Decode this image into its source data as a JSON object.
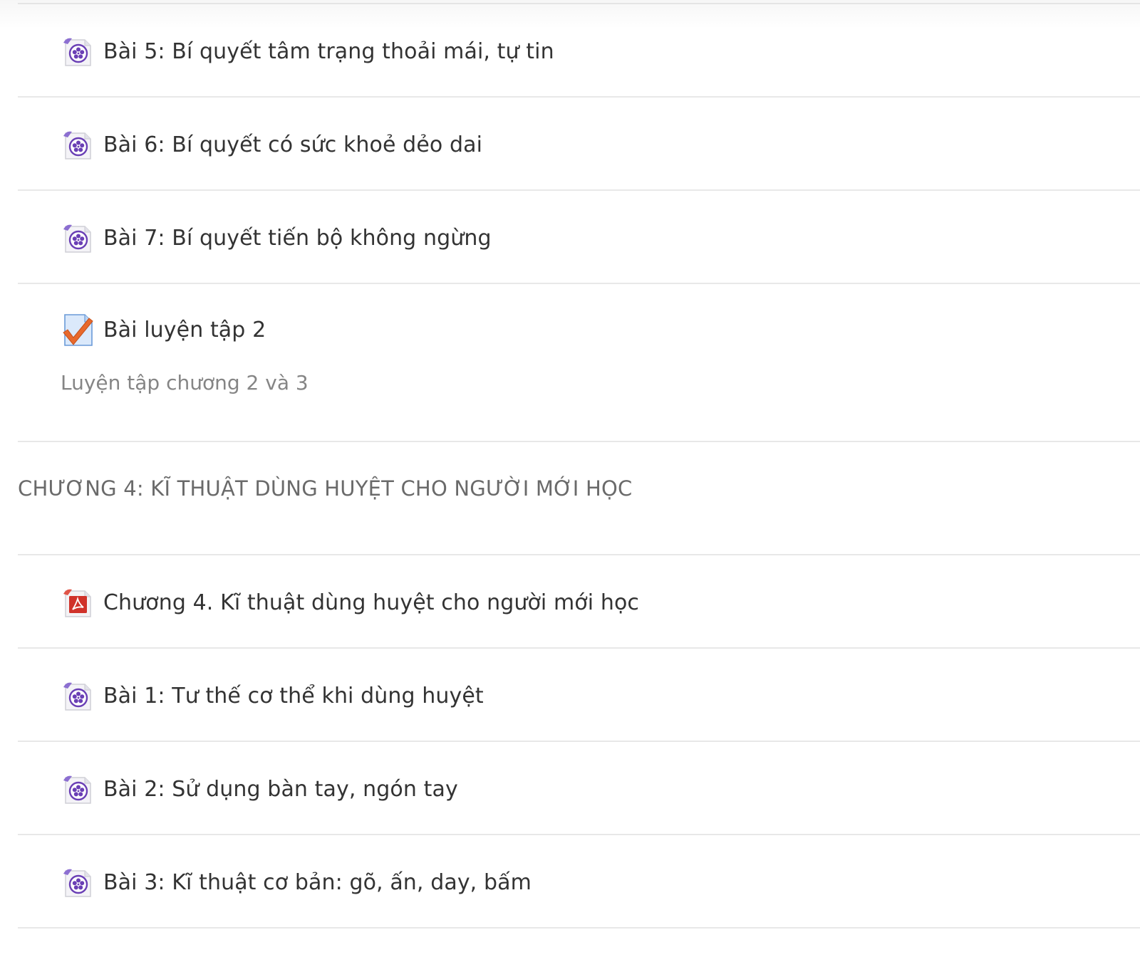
{
  "lessons_top": [
    {
      "title": "Bài 5: Bí quyết tâm trạng thoải mái, tự tin",
      "icon": "video-file-icon"
    },
    {
      "title": "Bài 6: Bí quyết có sức khoẻ dẻo dai",
      "icon": "video-file-icon"
    },
    {
      "title": "Bài 7: Bí quyết tiến bộ không ngừng",
      "icon": "video-file-icon"
    }
  ],
  "quiz": {
    "title": "Bài luyện tập 2",
    "description": "Luyện tập chương 2 và 3",
    "icon": "quiz-check-icon"
  },
  "section": {
    "title": "CHƯƠNG 4: KĨ THUẬT DÙNG HUYỆT CHO NGƯỜI MỚI HỌC"
  },
  "section_items": [
    {
      "title": "Chương 4. Kĩ thuật dùng huyệt cho người mới học",
      "icon": "pdf-file-icon"
    },
    {
      "title": "Bài 1: Tư thế cơ thể khi dùng huyệt",
      "icon": "video-file-icon"
    },
    {
      "title": "Bài 2: Sử dụng bàn tay, ngón tay",
      "icon": "video-file-icon"
    },
    {
      "title": "Bài 3: Kĩ thuật cơ bản: gõ, ấn, day, bấm",
      "icon": "video-file-icon"
    }
  ],
  "colors": {
    "video_icon": "#6a3fb5",
    "pdf_icon": "#d0322a",
    "check": "#e8692c",
    "divider": "#e8e8e8"
  }
}
